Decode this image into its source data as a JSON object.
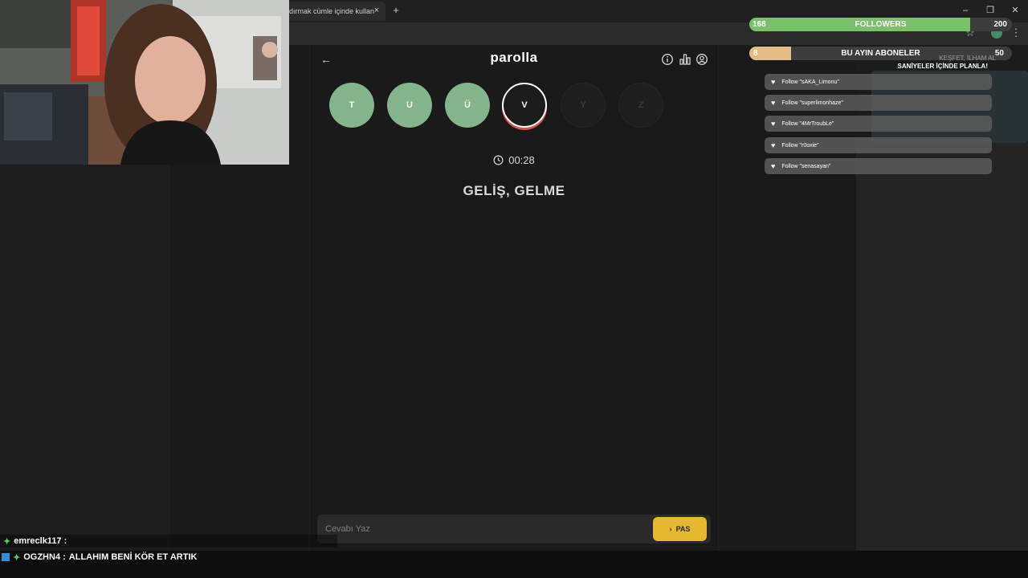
{
  "browser": {
    "tab_title": "dırmak cümle içinde kullan",
    "tab_close": "×",
    "new_tab": "+",
    "window_controls": [
      "–",
      "❐",
      "✕"
    ],
    "icons": [
      "star-icon",
      "kebab-menu-icon"
    ]
  },
  "app": {
    "title": "parolla",
    "back": "←",
    "header_icons": [
      "info-icon",
      "stats-icon",
      "user-icon"
    ],
    "letters": [
      {
        "letter": "T",
        "state": "done"
      },
      {
        "letter": "U",
        "state": "done"
      },
      {
        "letter": "Ü",
        "state": "done"
      },
      {
        "letter": "V",
        "state": "current"
      },
      {
        "letter": "Y",
        "state": "pending"
      },
      {
        "letter": "Z",
        "state": "pending"
      }
    ],
    "timer": "00:28",
    "clue": "GELİŞ, GELME",
    "input_placeholder": "Cevabı Yaz",
    "pass_label": "PAS",
    "pass_icon": "›"
  },
  "overlay": {
    "followers": {
      "current": "168",
      "title": "FOLLOWERS",
      "goal": "200",
      "progress": 0.84
    },
    "subs": {
      "current": "8",
      "title": "BU AYIN ABONELER",
      "goal": "50",
      "progress": 0.16
    },
    "ad": {
      "line1": "KEŞFET, İLHAM AL",
      "line2": "SANİYELER İÇİNDE PLANLA!"
    },
    "follows": [
      "Follow \"sAKA_Limonu\"",
      "Follow \"superlimonhaze\"",
      "Follow \"4MrTroubLe\"",
      "Follow \"r0oxie\"",
      "Follow \"senasayan\""
    ]
  },
  "chat": [
    {
      "user": "emreclk117 :",
      "message": ""
    },
    {
      "user": "OGZHN4 :",
      "message": "ALLAHIM BENİ KÖR ET ARTIK"
    }
  ],
  "colors": {
    "done": "#83b48e",
    "current_ring": "#d9534f",
    "pass": "#e5b830",
    "followers": "#7bc16c",
    "subs": "#e0be86"
  }
}
